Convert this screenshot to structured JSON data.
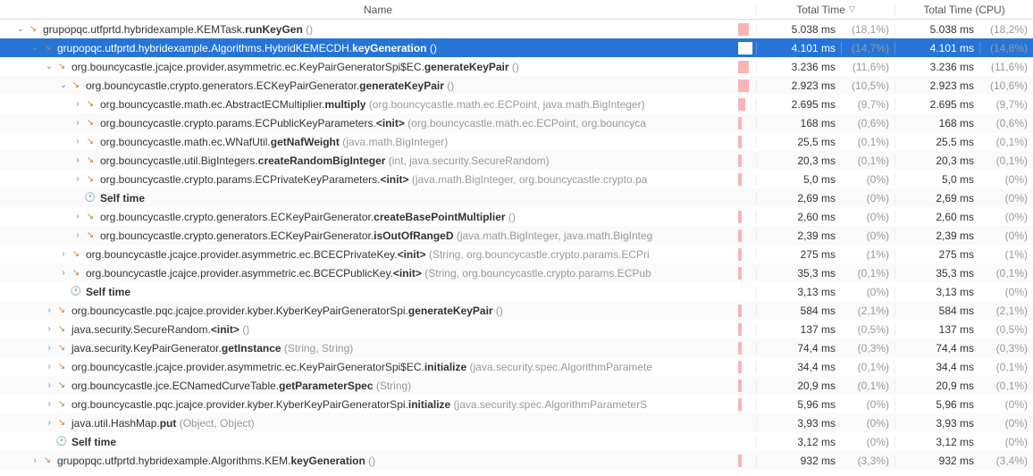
{
  "header": {
    "name": "Name",
    "total_time": "Total Time",
    "total_time_cpu": "Total Time (CPU)"
  },
  "rows": [
    {
      "indent": 1,
      "arrow": "down",
      "icon": "method",
      "pkg": "grupopqc.utfprtd.hybridexample.KEMTask.",
      "method": "runKeyGen",
      "params": " ()",
      "bar": 3,
      "tt": "5.038 ms",
      "tp": "(18,1%)",
      "ct": "5.038 ms",
      "cp": "(18,2%)",
      "selected": false
    },
    {
      "indent": 2,
      "arrow": "down",
      "icon": "method",
      "pkg": "grupopqc.utfprtd.hybridexample.Algorithms.HybridKEMECDH.",
      "method": "keyGeneration",
      "params": " ()",
      "bar": 4,
      "tt": "4.101 ms",
      "tp": "(14,7%)",
      "ct": "4.101 ms",
      "cp": "(14,8%)",
      "selected": true
    },
    {
      "indent": 3,
      "arrow": "down",
      "icon": "method",
      "pkg": "org.bouncycastle.jcajce.provider.asymmetric.ec.KeyPairGeneratorSpi$EC.",
      "method": "generateKeyPair",
      "params": " ()",
      "bar": 3,
      "tt": "3.236 ms",
      "tp": "(11,6%)",
      "ct": "3.236 ms",
      "cp": "(11,6%)",
      "selected": false
    },
    {
      "indent": 4,
      "arrow": "down",
      "icon": "method",
      "pkg": "org.bouncycastle.crypto.generators.ECKeyPairGenerator.",
      "method": "generateKeyPair",
      "params": " ()",
      "bar": 3,
      "tt": "2.923 ms",
      "tp": "(10,5%)",
      "ct": "2.923 ms",
      "cp": "(10,6%)",
      "selected": false
    },
    {
      "indent": 5,
      "arrow": "right",
      "icon": "method",
      "pkg": "org.bouncycastle.math.ec.AbstractECMultiplier.",
      "method": "multiply",
      "params": " (org.bouncycastle.math.ec.ECPoint, java.math.BigInteger)",
      "bar": 2,
      "tt": "2.695 ms",
      "tp": "(9,7%)",
      "ct": "2.695 ms",
      "cp": "(9,7%)",
      "selected": false
    },
    {
      "indent": 5,
      "arrow": "right",
      "icon": "method",
      "pkg": "org.bouncycastle.crypto.params.ECPublicKeyParameters.",
      "method": "<init>",
      "params": " (org.bouncycastle.math.ec.ECPoint, org.bouncyca",
      "bar": 1,
      "tt": "168 ms",
      "tp": "(0,6%)",
      "ct": "168 ms",
      "cp": "(0,6%)",
      "selected": false
    },
    {
      "indent": 5,
      "arrow": "right",
      "icon": "method",
      "pkg": "org.bouncycastle.math.ec.WNafUtil.",
      "method": "getNafWeight",
      "params": " (java.math.BigInteger)",
      "bar": 1,
      "tt": "25,5 ms",
      "tp": "(0,1%)",
      "ct": "25,5 ms",
      "cp": "(0,1%)",
      "selected": false
    },
    {
      "indent": 5,
      "arrow": "right",
      "icon": "method",
      "pkg": "org.bouncycastle.util.BigIntegers.",
      "method": "createRandomBigInteger",
      "params": " (int, java.security.SecureRandom)",
      "bar": 1,
      "tt": "20,3 ms",
      "tp": "(0,1%)",
      "ct": "20,3 ms",
      "cp": "(0,1%)",
      "selected": false
    },
    {
      "indent": 5,
      "arrow": "right",
      "icon": "method",
      "pkg": "org.bouncycastle.crypto.params.ECPrivateKeyParameters.",
      "method": "<init>",
      "params": " (java.math.BigInteger, org.bouncycastle.crypto.pa",
      "bar": 1,
      "tt": "5,0 ms",
      "tp": "(0%)",
      "ct": "5,0 ms",
      "cp": "(0%)",
      "selected": false
    },
    {
      "indent": 5,
      "arrow": "",
      "icon": "clock",
      "pkg": "",
      "method": "Self time",
      "params": "",
      "bar": 0,
      "tt": "2,69 ms",
      "tp": "(0%)",
      "ct": "2,69 ms",
      "cp": "(0%)",
      "selected": false
    },
    {
      "indent": 5,
      "arrow": "right",
      "icon": "method",
      "pkg": "org.bouncycastle.crypto.generators.ECKeyPairGenerator.",
      "method": "createBasePointMultiplier",
      "params": " ()",
      "bar": 1,
      "tt": "2,60 ms",
      "tp": "(0%)",
      "ct": "2,60 ms",
      "cp": "(0%)",
      "selected": false
    },
    {
      "indent": 5,
      "arrow": "right",
      "icon": "method",
      "pkg": "org.bouncycastle.crypto.generators.ECKeyPairGenerator.",
      "method": "isOutOfRangeD",
      "params": " (java.math.BigInteger, java.math.BigInteg",
      "bar": 1,
      "tt": "2,39 ms",
      "tp": "(0%)",
      "ct": "2,39 ms",
      "cp": "(0%)",
      "selected": false
    },
    {
      "indent": 4,
      "arrow": "right",
      "icon": "method",
      "pkg": "org.bouncycastle.jcajce.provider.asymmetric.ec.BCECPrivateKey.",
      "method": "<init>",
      "params": " (String, org.bouncycastle.crypto.params.ECPri",
      "bar": 1,
      "tt": "275 ms",
      "tp": "(1%)",
      "ct": "275 ms",
      "cp": "(1%)",
      "selected": false
    },
    {
      "indent": 4,
      "arrow": "right",
      "icon": "method",
      "pkg": "org.bouncycastle.jcajce.provider.asymmetric.ec.BCECPublicKey.",
      "method": "<init>",
      "params": " (String, org.bouncycastle.crypto.params.ECPub",
      "bar": 1,
      "tt": "35,3 ms",
      "tp": "(0,1%)",
      "ct": "35,3 ms",
      "cp": "(0,1%)",
      "selected": false
    },
    {
      "indent": 4,
      "arrow": "",
      "icon": "clock",
      "pkg": "",
      "method": "Self time",
      "params": "",
      "bar": 0,
      "tt": "3,13 ms",
      "tp": "(0%)",
      "ct": "3,13 ms",
      "cp": "(0%)",
      "selected": false
    },
    {
      "indent": 3,
      "arrow": "right",
      "icon": "method",
      "pkg": "org.bouncycastle.pqc.jcajce.provider.kyber.KyberKeyPairGeneratorSpi.",
      "method": "generateKeyPair",
      "params": " ()",
      "bar": 1,
      "tt": "584 ms",
      "tp": "(2,1%)",
      "ct": "584 ms",
      "cp": "(2,1%)",
      "selected": false
    },
    {
      "indent": 3,
      "arrow": "right",
      "icon": "method",
      "pkg": "java.security.SecureRandom.",
      "method": "<init>",
      "params": " ()",
      "bar": 1,
      "tt": "137 ms",
      "tp": "(0,5%)",
      "ct": "137 ms",
      "cp": "(0,5%)",
      "selected": false
    },
    {
      "indent": 3,
      "arrow": "right",
      "icon": "method",
      "pkg": "java.security.KeyPairGenerator.",
      "method": "getInstance",
      "params": " (String, String)",
      "bar": 1,
      "tt": "74,4 ms",
      "tp": "(0,3%)",
      "ct": "74,4 ms",
      "cp": "(0,3%)",
      "selected": false
    },
    {
      "indent": 3,
      "arrow": "right",
      "icon": "method",
      "pkg": "org.bouncycastle.jcajce.provider.asymmetric.ec.KeyPairGeneratorSpi$EC.",
      "method": "initialize",
      "params": " (java.security.spec.AlgorithmParamete",
      "bar": 1,
      "tt": "34,4 ms",
      "tp": "(0,1%)",
      "ct": "34,4 ms",
      "cp": "(0,1%)",
      "selected": false
    },
    {
      "indent": 3,
      "arrow": "right",
      "icon": "method",
      "pkg": "org.bouncycastle.jce.ECNamedCurveTable.",
      "method": "getParameterSpec",
      "params": " (String)",
      "bar": 1,
      "tt": "20,9 ms",
      "tp": "(0,1%)",
      "ct": "20,9 ms",
      "cp": "(0,1%)",
      "selected": false
    },
    {
      "indent": 3,
      "arrow": "right",
      "icon": "method",
      "pkg": "org.bouncycastle.pqc.jcajce.provider.kyber.KyberKeyPairGeneratorSpi.",
      "method": "initialize",
      "params": " (java.security.spec.AlgorithmParameterS",
      "bar": 1,
      "tt": "5,96 ms",
      "tp": "(0%)",
      "ct": "5,96 ms",
      "cp": "(0%)",
      "selected": false
    },
    {
      "indent": 3,
      "arrow": "right",
      "icon": "method",
      "pkg": "java.util.HashMap.",
      "method": "put",
      "params": " (Object, Object)",
      "bar": 0,
      "tt": "3,93 ms",
      "tp": "(0%)",
      "ct": "3,93 ms",
      "cp": "(0%)",
      "selected": false
    },
    {
      "indent": 3,
      "arrow": "",
      "icon": "clock",
      "pkg": "",
      "method": "Self time",
      "params": "",
      "bar": 0,
      "tt": "3,12 ms",
      "tp": "(0%)",
      "ct": "3,12 ms",
      "cp": "(0%)",
      "selected": false
    },
    {
      "indent": 2,
      "arrow": "right",
      "icon": "method",
      "pkg": "grupopqc.utfprtd.hybridexample.Algorithms.KEM.",
      "method": "keyGeneration",
      "params": " ()",
      "bar": 1,
      "tt": "932 ms",
      "tp": "(3,3%)",
      "ct": "932 ms",
      "cp": "(3,4%)",
      "selected": false
    }
  ]
}
